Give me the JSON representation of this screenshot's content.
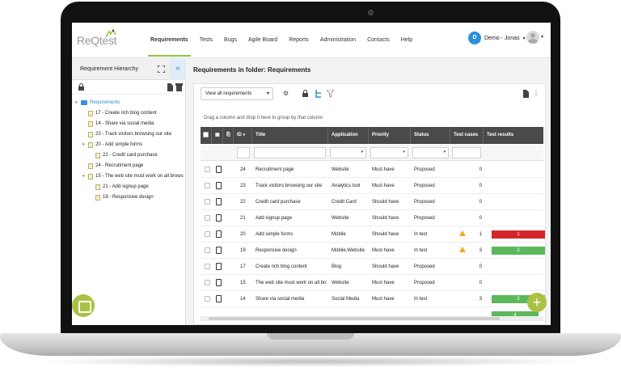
{
  "brand": {
    "logo_text": "ReQtest"
  },
  "nav": {
    "items": [
      {
        "label": "Requirements",
        "active": true
      },
      {
        "label": "Tests"
      },
      {
        "label": "Bugs"
      },
      {
        "label": "Agile Board"
      },
      {
        "label": "Reports"
      },
      {
        "label": "Administration"
      },
      {
        "label": "Contacts"
      },
      {
        "label": "Help"
      }
    ]
  },
  "user": {
    "initial": "D",
    "name": "Demo - Jonas"
  },
  "left_panel": {
    "title": "Requirement Hierarchy",
    "collapse_glyph": "«",
    "tree": [
      {
        "label": "Requirements",
        "type": "folder",
        "level": 0
      },
      {
        "label": "17 - Create rich blog content",
        "type": "doc",
        "level": 1
      },
      {
        "label": "14 - Share via social media",
        "type": "doc",
        "level": 1
      },
      {
        "label": "23 - Track visitors browsing our site",
        "type": "doc",
        "level": 1
      },
      {
        "label": "20 - Add simple forms",
        "type": "doc",
        "level": 1
      },
      {
        "label": "22 - Credit card purchase",
        "type": "doc",
        "level": 2
      },
      {
        "label": "24 - Recruitment page",
        "type": "doc",
        "level": 1
      },
      {
        "label": "15 - The web site must work on all brows",
        "type": "doc",
        "level": 1
      },
      {
        "label": "21 - Add signup page",
        "type": "doc",
        "level": 2
      },
      {
        "label": "19 - Responsive design",
        "type": "doc",
        "level": 2
      }
    ]
  },
  "main": {
    "title": "Requirements in folder: Requirements",
    "view_select": "View all requirements",
    "grouping_hint": "Drag a column and drop it here to group by that column",
    "columns": {
      "id": "ID",
      "title": "Title",
      "application": "Application",
      "priority": "Priority",
      "status": "Status",
      "test_cases": "Test cases",
      "test_results": "Test results"
    },
    "rows": [
      {
        "id": "24",
        "title": "Recruitment page",
        "application": "Website",
        "priority": "Must have",
        "status": "Proposed",
        "test_cases": "0"
      },
      {
        "id": "23",
        "title": "Track visitors browsing our site",
        "application": "Analytics tool",
        "priority": "Must have",
        "status": "Proposed",
        "test_cases": "0"
      },
      {
        "id": "22",
        "title": "Credit card purchase",
        "application": "Credit Card",
        "priority": "Should have",
        "status": "Proposed",
        "test_cases": "0"
      },
      {
        "id": "21",
        "title": "Add signup page",
        "application": "Website",
        "priority": "Should have",
        "status": "Proposed",
        "test_cases": "0"
      },
      {
        "id": "20",
        "title": "Add simple forms",
        "application": "Mobile",
        "priority": "Should have",
        "status": "In test",
        "test_cases": "1",
        "warning": true,
        "result": {
          "value": "1",
          "color": "#d4252a"
        }
      },
      {
        "id": "19",
        "title": "Responsive design",
        "application": "Mobile,Website",
        "priority": "Must have",
        "status": "In test",
        "test_cases": "3",
        "warning": true,
        "result": {
          "value": "2",
          "color": "#5cb85c"
        }
      },
      {
        "id": "17",
        "title": "Create rich blog content",
        "application": "Blog",
        "priority": "Should have",
        "status": "Proposed",
        "test_cases": "0"
      },
      {
        "id": "15",
        "title": "The web site must work on all bro...",
        "application": "Website",
        "priority": "Must have",
        "status": "Proposed",
        "test_cases": "0"
      },
      {
        "id": "14",
        "title": "Share via social media",
        "application": "Social Media",
        "priority": "Must have",
        "status": "In test",
        "test_cases": "3",
        "result": {
          "value": "2",
          "color": "#5cb85c"
        }
      },
      {
        "id": "",
        "title": "",
        "application": "",
        "priority": "",
        "status": "",
        "test_cases": "",
        "result": {
          "value": "4",
          "color": "#5cb85c"
        }
      }
    ]
  },
  "fab_glyph": "+",
  "colors": {
    "accent": "#8dc63f",
    "blue": "#2b8fd6",
    "header": "#4a4a4a"
  }
}
